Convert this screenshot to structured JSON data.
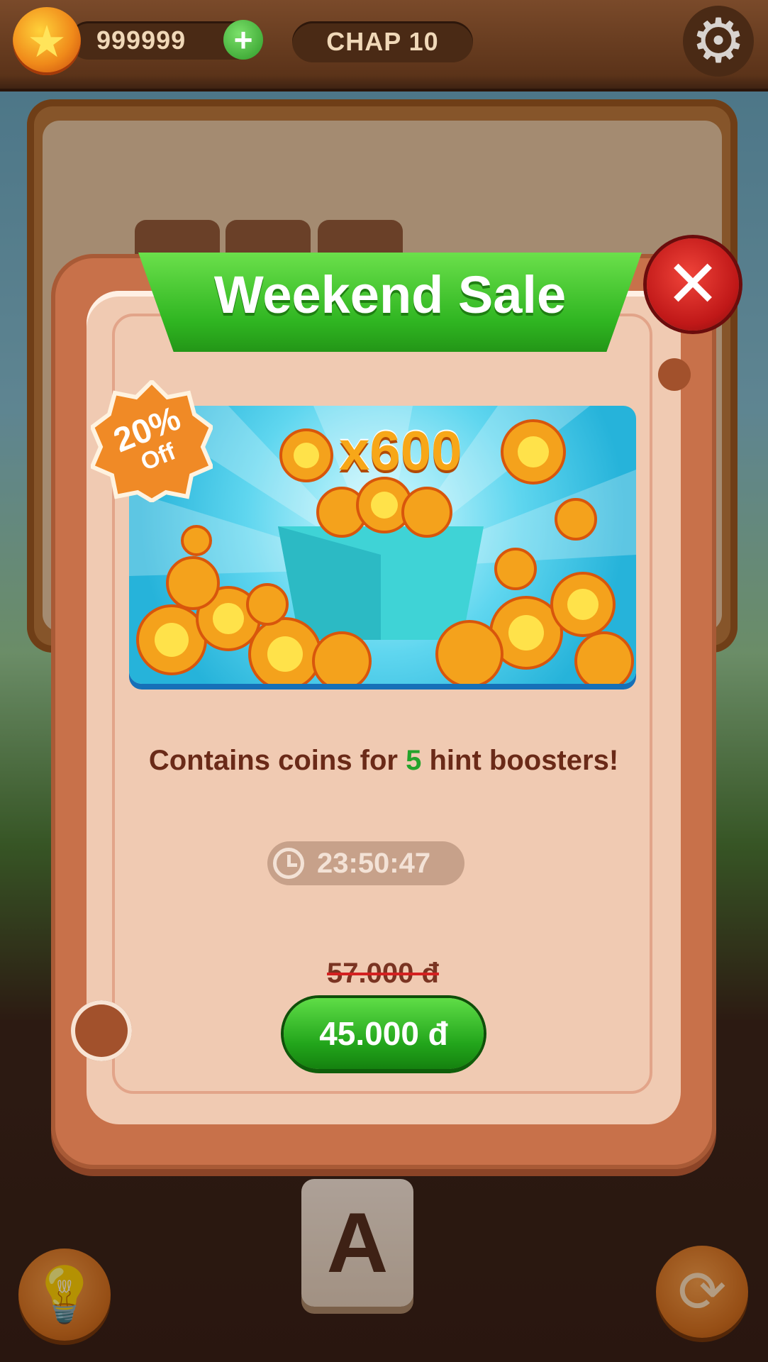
{
  "topbar": {
    "coin_icon": "star-coin-icon",
    "coin_value": "999999",
    "add_coin_symbol": "+",
    "chapter_label": "CHAP 10",
    "settings_icon": "gear-icon"
  },
  "offer": {
    "title": "Weekend Sale",
    "discount": {
      "percent": "20%",
      "label": "Off"
    },
    "bundle_count": "x600",
    "description": {
      "before": "Contains coins for ",
      "count": "5",
      "after": " hint boosters!"
    },
    "timer": "23:50:47",
    "old_price": "57.000 đ",
    "price": "45.000 đ",
    "close_icon": "close-icon"
  },
  "board": {
    "tile_letter": "A"
  },
  "bottom": {
    "hint_icon": "lightbulb-icon",
    "shuffle_icon": "shuffle-icon"
  },
  "colors": {
    "accent_green": "#2fb521",
    "close_red": "#c01818",
    "card_bg": "#f0cab2",
    "text_brown": "#6a2a18",
    "highlight_green": "#23a32b",
    "strike_red": "#d42020"
  }
}
